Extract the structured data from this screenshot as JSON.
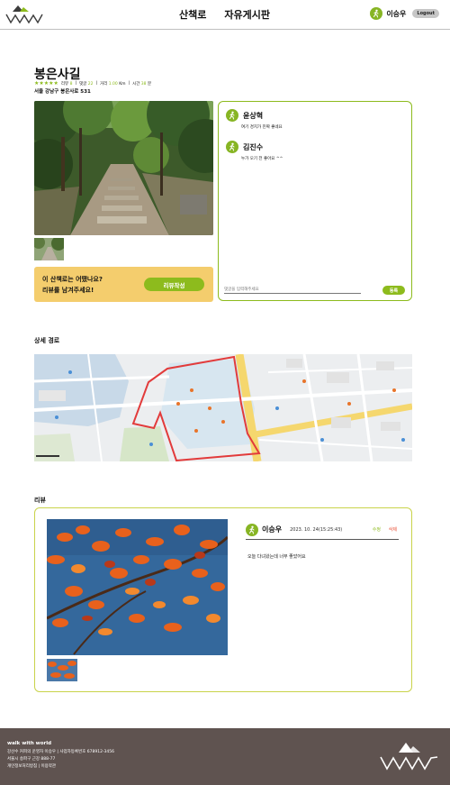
{
  "header": {
    "nav": [
      "산책로",
      "자유게시판"
    ],
    "user_name": "이승우",
    "logout_label": "Logout"
  },
  "trail": {
    "name": "봉은사길",
    "stars": "★★★★★",
    "review_label": "리뷰",
    "review_count": "8",
    "comment_label": "댓글",
    "comment_count": "22",
    "distance_label": "거리",
    "distance_value": "1.00",
    "distance_unit": "Km",
    "time_label": "시간",
    "time_value": "38",
    "time_unit": "분",
    "address": "서울 강남구 봉은사로 531"
  },
  "prompt": {
    "line1": "이 산책로는 어땠나요?",
    "line2": "리뷰를 남겨주세요!",
    "button": "리뷰작성"
  },
  "comments": {
    "items": [
      {
        "name": "윤상혁",
        "text": "여기 경치가 진짜 좋네요"
      },
      {
        "name": "김진수",
        "text": "누가 오기 전 좋아요 ^^"
      }
    ],
    "placeholder": "댓글을 입력해주세요",
    "submit": "등록"
  },
  "map_section": {
    "title": "상세 경로"
  },
  "review_section": {
    "title": "리뷰",
    "author": "이승우",
    "date": "2023. 10. 24(15:25:43)",
    "edit": "수정",
    "delete": "삭제",
    "text": "오늘 다녀왔는데 너무 좋았어요"
  },
  "footer": {
    "brand": "walk with world",
    "line1": "강산수 커피의 운영자 이승우 | 사업자등록번호 678912-3456",
    "line2": "서울시 송파구 근강 888-77",
    "line3": "개인정보처리방침 | 이용약관"
  },
  "colors": {
    "accent": "#8dbb1d",
    "prompt_bg": "#f4cd6d",
    "footer_bg": "#5f5350",
    "delete_red": "#e84a2f"
  }
}
